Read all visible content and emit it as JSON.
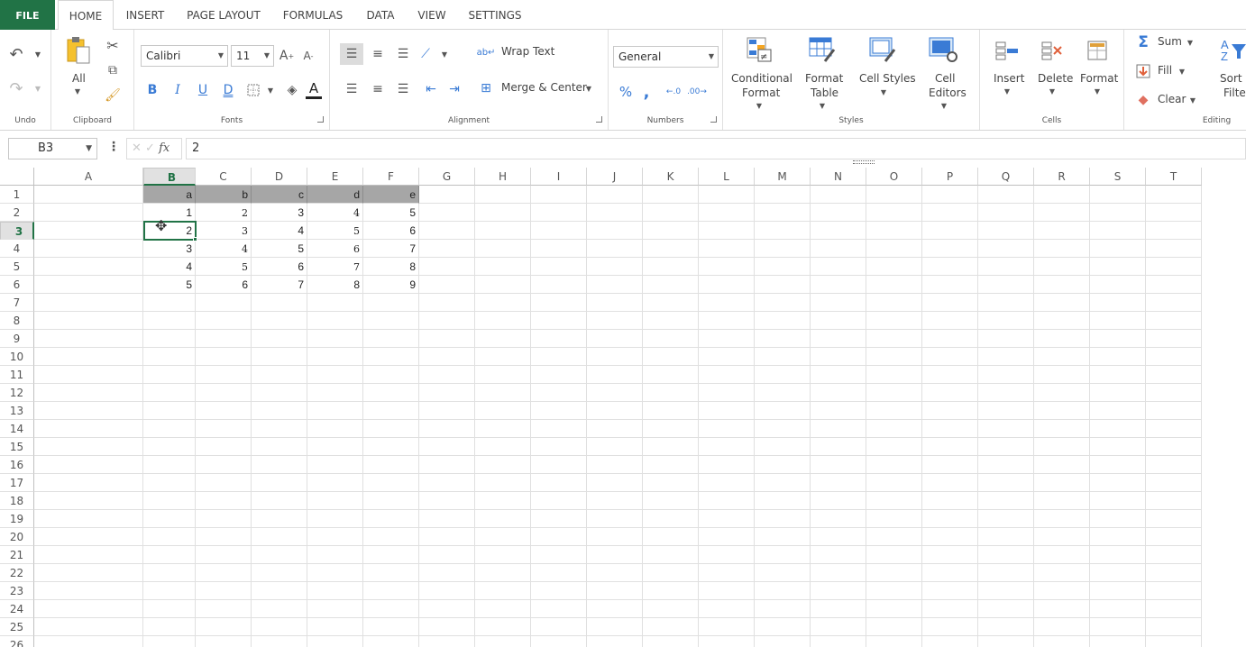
{
  "tabs": {
    "file": "FILE",
    "home": "HOME",
    "insert": "INSERT",
    "page_layout": "PAGE LAYOUT",
    "formulas": "FORMULAS",
    "data": "DATA",
    "view": "VIEW",
    "settings": "SETTINGS"
  },
  "ribbon": {
    "undo": {
      "label": "Undo"
    },
    "clipboard": {
      "label": "Clipboard",
      "paste": "All"
    },
    "fonts": {
      "label": "Fonts",
      "family": "Calibri",
      "size": "11"
    },
    "alignment": {
      "label": "Alignment",
      "wrap": "Wrap Text",
      "merge": "Merge & Center"
    },
    "numbers": {
      "label": "Numbers",
      "format": "General"
    },
    "styles": {
      "label": "Styles",
      "conditional_1": "Conditional",
      "conditional_2": "Format",
      "format_table_1": "Format",
      "format_table_2": "Table",
      "cell_styles": "Cell Styles",
      "cell_editors_1": "Cell",
      "cell_editors_2": "Editors"
    },
    "cells": {
      "label": "Cells",
      "insert": "Insert",
      "delete": "Delete",
      "format": "Format"
    },
    "editing": {
      "label": "Editing",
      "sum": "Sum",
      "fill": "Fill",
      "clear": "Clear",
      "sort_1": "Sort &",
      "sort_2": "Filter"
    }
  },
  "formula_bar": {
    "name_box": "B3",
    "fx": "fx",
    "value": "2"
  },
  "columns": [
    "A",
    "B",
    "C",
    "D",
    "E",
    "F",
    "G",
    "H",
    "I",
    "J",
    "K",
    "L",
    "M",
    "N",
    "O",
    "P",
    "Q",
    "R",
    "S",
    "T"
  ],
  "rows": [
    "1",
    "2",
    "3",
    "4",
    "5",
    "6",
    "7",
    "8",
    "9",
    "10",
    "11",
    "12",
    "13",
    "14",
    "15",
    "16",
    "17",
    "18",
    "19",
    "20",
    "21",
    "22",
    "23",
    "24",
    "25",
    "26"
  ],
  "selected": {
    "col": "B",
    "row": "3"
  },
  "grid": [
    [
      "a",
      "b",
      "c",
      "d",
      "e"
    ],
    [
      "1",
      "2",
      "3",
      "4",
      "5"
    ],
    [
      "2",
      "3",
      "4",
      "5",
      "6"
    ],
    [
      "3",
      "4",
      "5",
      "6",
      "7"
    ],
    [
      "4",
      "5",
      "6",
      "7",
      "8"
    ],
    [
      "5",
      "6",
      "7",
      "8",
      "9"
    ]
  ],
  "colors": {
    "accent": "#217346",
    "header_fill": "#a6a6a6"
  }
}
